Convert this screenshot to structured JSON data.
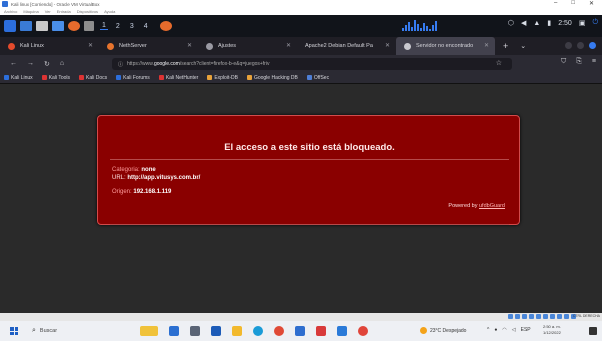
{
  "vbox": {
    "title": "Kali linux [Corriendo] - Oracle VM VirtualBox",
    "menu": [
      "Archivo",
      "Máquina",
      "Ver",
      "Entrada",
      "Dispositivos",
      "Ayuda"
    ],
    "win_controls": [
      "–",
      "□",
      "✕"
    ]
  },
  "panel": {
    "workspaces": [
      "1",
      "2",
      "3",
      "4"
    ],
    "clock": "2:50",
    "colors": {
      "bg": "#11141a",
      "accent": "#367bf0"
    }
  },
  "tabs": [
    {
      "title": "Kali Linux",
      "icon": "kali-icon"
    },
    {
      "title": "NethServer",
      "icon": "nethserver-icon"
    },
    {
      "title": "Ajustes",
      "icon": "gear-icon"
    },
    {
      "title": "Apache2 Debian Default Pa",
      "icon": "apache-icon"
    },
    {
      "title": "Servidor no encontrado",
      "icon": "warning-icon"
    }
  ],
  "nav": {
    "url_prefix": "https://www.",
    "url_host": "google.com",
    "url_rest": "/search?client=firefox-b-e&q=juegos+friv"
  },
  "bookmarks": [
    {
      "label": "Kali Linux",
      "color": "#2c6edc"
    },
    {
      "label": "Kali Tools",
      "color": "#d33"
    },
    {
      "label": "Kali Docs",
      "color": "#d33"
    },
    {
      "label": "Kali Forums",
      "color": "#2c6edc"
    },
    {
      "label": "Kali NetHunter",
      "color": "#d33"
    },
    {
      "label": "Exploit-DB",
      "color": "#e8a23a"
    },
    {
      "label": "Google Hacking DB",
      "color": "#e8a23a"
    },
    {
      "label": "OffSec",
      "color": "#4e7fd6"
    }
  ],
  "block_page": {
    "title": "El acceso a este sitio está bloqueado.",
    "category_label": "Categoria:",
    "category_value": "none",
    "url_label": "URL:",
    "url_value": "http://app.vitusys.com.br/",
    "origin_label": "Origen:",
    "origin_value": "192.168.1.119",
    "footer_text": "Powered by",
    "footer_link": "ufdbGuard",
    "colors": {
      "bg": "#8a0000",
      "border": "#d24b4b"
    }
  },
  "vb_status": {
    "host_key": "CTRL DERECHA"
  },
  "taskbar": {
    "search_placeholder": "Buscar",
    "weather": "23°C Despejado",
    "time": "2:50 a. m.",
    "date": "1/12/2022",
    "tray": [
      "^",
      "ESP"
    ]
  }
}
